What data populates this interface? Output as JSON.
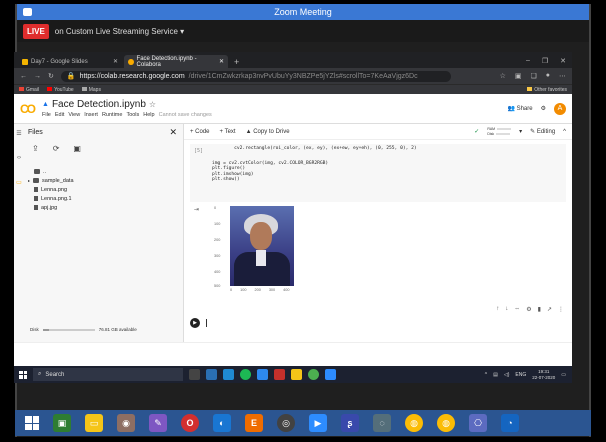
{
  "zoom": {
    "title": "Zoom Meeting",
    "live_badge": "LIVE",
    "live_text": "on Custom Live Streaming Service ▾"
  },
  "browser": {
    "tabs": [
      {
        "label": "Day7 - Google Slides",
        "color": "#f4b400"
      },
      {
        "label": "Face Detection.ipynb - Colabora",
        "color": "#f9ab00"
      }
    ],
    "url_main": "https://colab.research.google.com",
    "url_rest": "/drive/1CmZwkzrkap3nvPvUbuYy3NBZPe5jYZls#scrollTo=7KeAaVjgz6Dc",
    "bookmarks": [
      "Gmail",
      "YouTube",
      "Maps"
    ],
    "other_bookmarks": "Other favorites"
  },
  "colab": {
    "logo": "CO",
    "title": "Face Detection.ipynb",
    "star": "☆",
    "menu": [
      "File",
      "Edit",
      "View",
      "Insert",
      "Runtime",
      "Tools",
      "Help"
    ],
    "menu_note": "Cannot save changes",
    "share": "Share",
    "avatar": "A",
    "files_title": "Files",
    "tree": [
      {
        "name": "..",
        "type": "folder"
      },
      {
        "name": "sample_data",
        "type": "folder"
      },
      {
        "name": "Lenna.png",
        "type": "file"
      },
      {
        "name": "Lenna.png.1",
        "type": "file"
      },
      {
        "name": "apj.jpg",
        "type": "file"
      }
    ],
    "disk_label": "Disk",
    "disk_text": "76.81 GB available",
    "toolbar": {
      "add_code": "+ Code",
      "add_text": "+ Text",
      "copy_drive": "Copy to Drive",
      "ram": "RAM",
      "disk": "Disk",
      "editing": "Editing"
    },
    "cell": {
      "exec_count": "[5]",
      "lines_top": [
        "        cv2.rectangle(roi_color, (ex, ey), (ex+ew, ey+eh), (0, 255, 0), 2)"
      ],
      "lines_bottom": [
        "img = cv2.cvtColor(img, cv2.COLOR_BGR2RGB)",
        "plt.figure()",
        "plt.imshow(img)",
        "plt.show()"
      ]
    },
    "plot_yticks": [
      "0",
      "100",
      "200",
      "300",
      "400",
      "500"
    ],
    "plot_xticks": [
      "0",
      "100",
      "200",
      "300",
      "400"
    ]
  },
  "taskbar_inner": {
    "search_placeholder": "Search",
    "lang": "ENG",
    "time": "19:31",
    "date": "22-07-2020"
  }
}
